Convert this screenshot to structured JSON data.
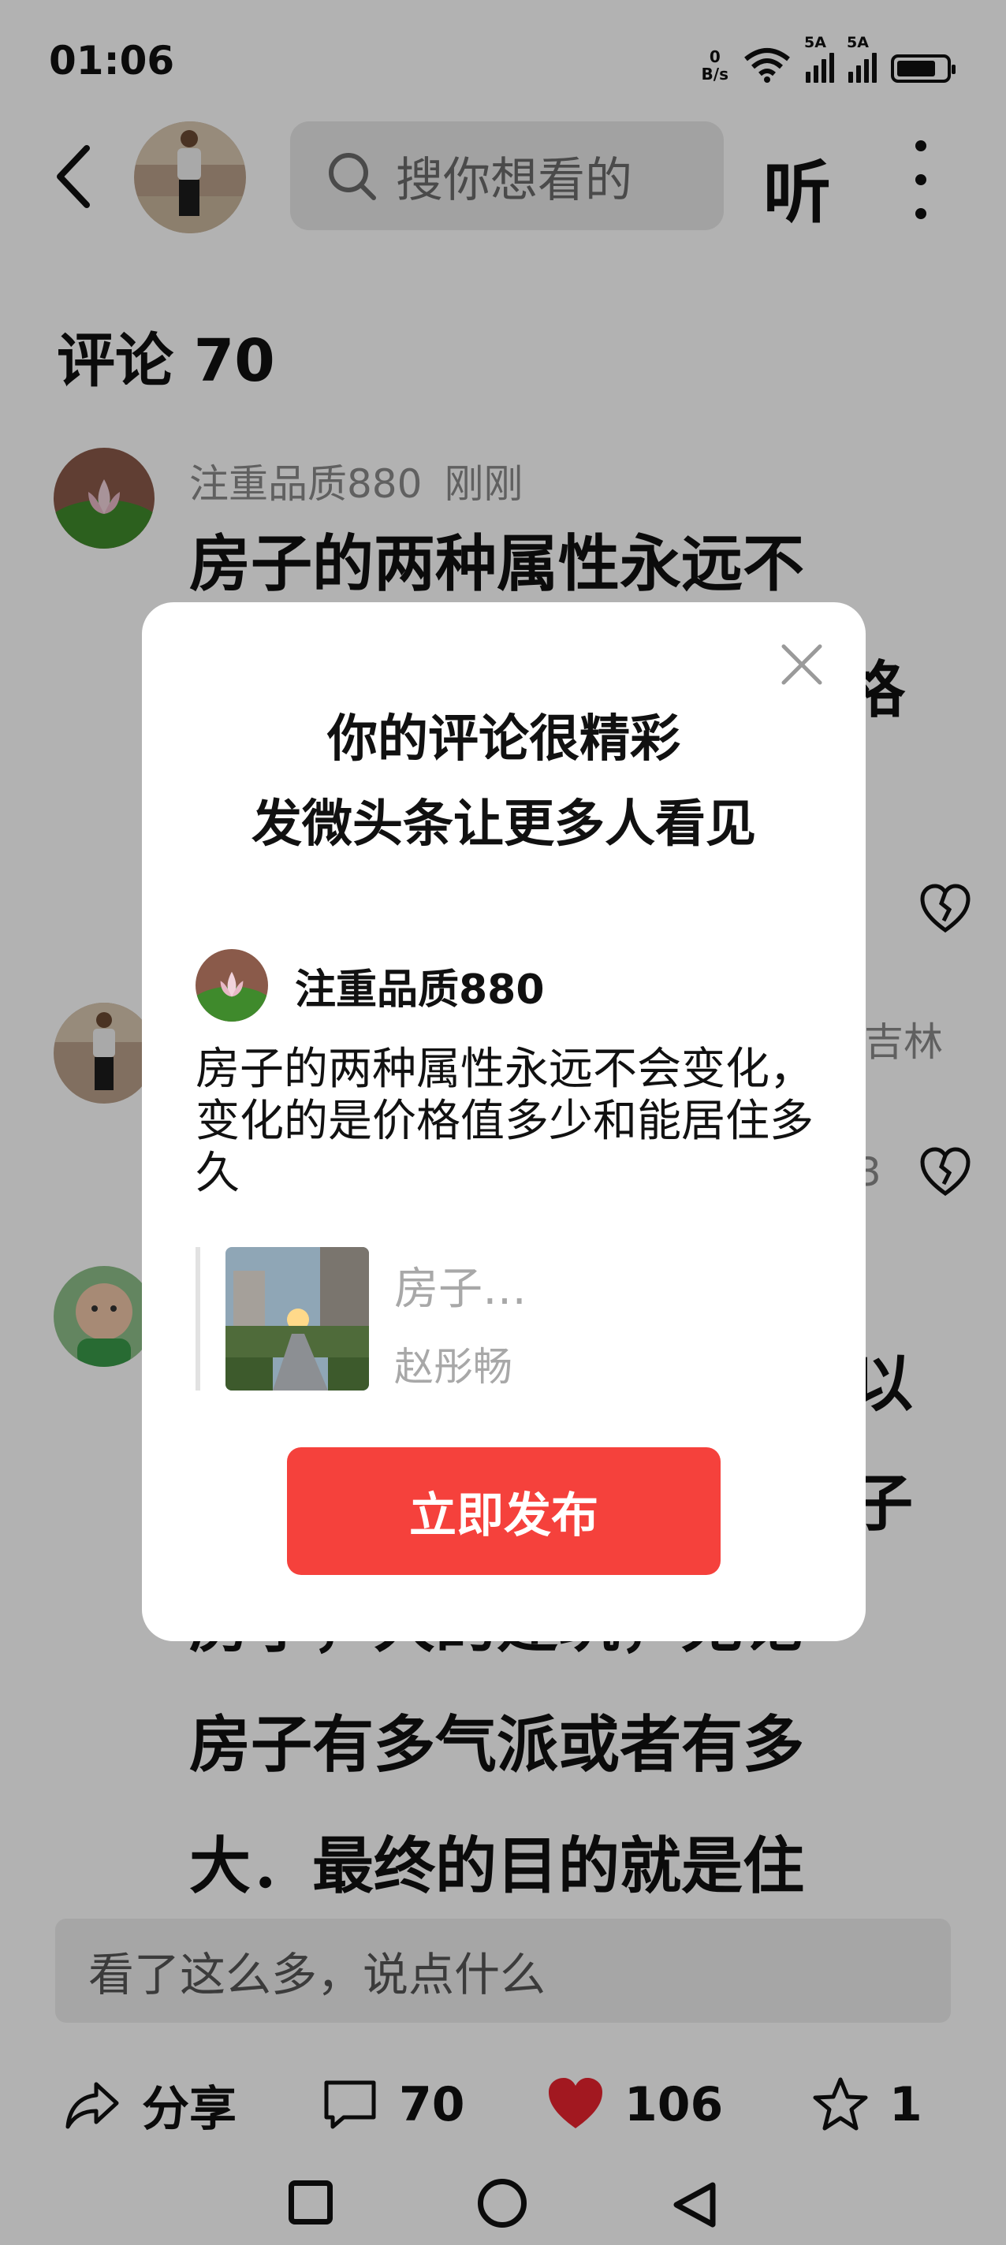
{
  "status_bar": {
    "time": "01:06",
    "net_speed_value": "0",
    "net_speed_unit": "B/s",
    "signal1_label": "5A",
    "signal2_label": "5A",
    "battery_level": 0.8
  },
  "top_bar": {
    "search_placeholder": "搜你想看的",
    "listen_label": "听"
  },
  "comments": {
    "title": "评论 70",
    "items": [
      {
        "author": "注重品质880",
        "time": "刚刚",
        "text_line1": "房子的两种属性永远不",
        "text_line2": "格"
      },
      {
        "author_fragment": "吉林",
        "side_fragment": "3"
      },
      {
        "text_lines": [
          "以",
          "子",
          "房子，大的建筑，无论",
          "房子有多气派或者有多",
          "大．最终的目的就是住"
        ]
      }
    ]
  },
  "input_bar": {
    "placeholder": "看了这么多，说点什么"
  },
  "actions": {
    "share_label": "分享",
    "comment_count": "70",
    "like_count": "106",
    "favorite_count": "1"
  },
  "modal": {
    "title_line1": "你的评论很精彩",
    "title_line2": "发微头条让更多人看见",
    "author": "注重品质880",
    "comment_text": "房子的两种属性永远不会变化，变化的是价格值多少和能居住多久",
    "quoted_title": "房子…",
    "quoted_author": "赵彤畅",
    "publish_label": "立即发布"
  },
  "colors": {
    "accent_red": "#f5413c",
    "like_red": "#e8232f"
  }
}
